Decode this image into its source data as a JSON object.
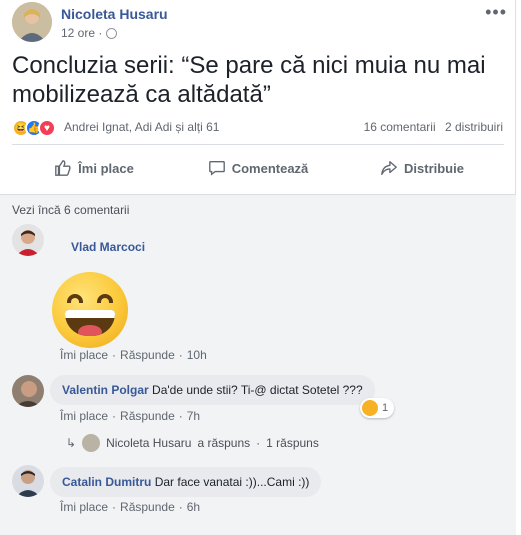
{
  "post": {
    "author": "Nicoleta Husaru",
    "time": "12 ore ·",
    "text": "Concluzia serii: “Se pare că nici muia nu mai mobilizează ca altădată”",
    "reaction_names": "Andrei Ignat, Adi Adi și alți 61",
    "comments_count": "16 comentarii",
    "shares_count": "2 distribuiri",
    "more_icon": "ellipsis-icon",
    "privacy_icon": "globe-icon",
    "reactions": [
      "haha",
      "like",
      "love"
    ],
    "colors": {
      "link": "#385898",
      "haha": "#f7b125",
      "like": "#2078f4",
      "love": "#f33e58"
    }
  },
  "actions": {
    "like": "Îmi place",
    "comment": "Comentează",
    "share": "Distribuie"
  },
  "comments_section": {
    "view_more": "Vezi încă 6 comentarii",
    "comments": [
      {
        "author": "Vlad Marcoci",
        "text": "",
        "sticker": "laughing-sticker",
        "like": "Îmi place",
        "reply": "Răspunde",
        "time": "10h"
      },
      {
        "author": "Valentin Polgar",
        "text": "Da'de unde stii? Ti-@ dictat Sotetel ???",
        "reaction_count": "1",
        "like": "Îmi place",
        "reply": "Răspunde",
        "time": "7h",
        "replies_summary": {
          "author": "Nicoleta Husaru",
          "action": "a răspuns",
          "count": "1 răspuns"
        }
      },
      {
        "author": "Catalin Dumitru",
        "text": "Dar face vanatai :))...Cami :))",
        "like": "Îmi place",
        "reply": "Răspunde",
        "time": "6h"
      }
    ]
  }
}
